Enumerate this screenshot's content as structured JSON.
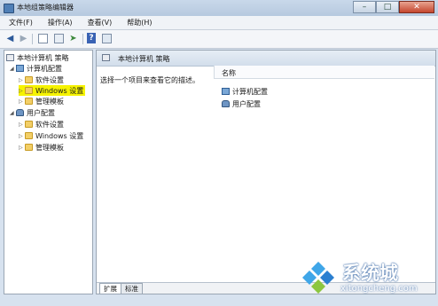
{
  "window": {
    "title": "本地组策略编辑器"
  },
  "menu": {
    "items": [
      "文件(F)",
      "操作(A)",
      "查看(V)",
      "帮助(H)"
    ]
  },
  "tree": {
    "root": "本地计算机 策略",
    "computer": "计算机配置",
    "computer_children": [
      "软件设置",
      "Windows 设置",
      "管理模板"
    ],
    "user": "用户配置",
    "user_children": [
      "软件设置",
      "Windows 设置",
      "管理模板"
    ]
  },
  "right": {
    "header": "本地计算机 策略",
    "description": "选择一个项目来查看它的描述。",
    "column_name": "名称",
    "items": [
      "计算机配置",
      "用户配置"
    ]
  },
  "tabs": [
    "扩展",
    "标准"
  ],
  "watermark": {
    "brand": "系统城",
    "url": "xitongcheng.com"
  },
  "colors": {
    "highlight": "#f6f300",
    "accent": "#2b5ea0"
  }
}
